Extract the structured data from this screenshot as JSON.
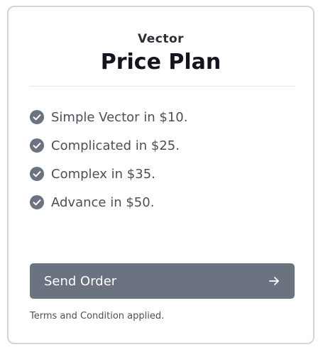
{
  "plan": {
    "subtitle": "Vector",
    "title": "Price Plan"
  },
  "features": [
    {
      "label": "Simple Vector in $10.",
      "icon": "check-circle-icon"
    },
    {
      "label": "Complicated in $25.",
      "icon": "check-circle-icon"
    },
    {
      "label": "Complex in $35.",
      "icon": "check-circle-icon"
    },
    {
      "label": "Advance in $50.",
      "icon": "check-circle-icon"
    }
  ],
  "order_button": {
    "label": "Send Order",
    "icon": "arrow-right-icon"
  },
  "terms": "Terms and Condition applied.",
  "colors": {
    "button_bg": "#6b7280",
    "check_icon": "#6b7280",
    "text": "#4a4f5a",
    "title": "#12151b"
  }
}
